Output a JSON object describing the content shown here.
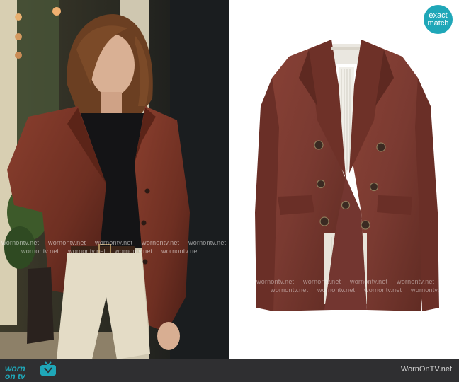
{
  "badge": {
    "line1": "exact",
    "line2": "match"
  },
  "footer": {
    "logo_line1": "worn",
    "logo_line2": "on tv",
    "site": "WornOnTV.net"
  },
  "watermark": "wornontv.net",
  "colors": {
    "badge_teal": "#1fa7b8",
    "footer_bg": "#2f2f31",
    "jacket_brown": "#7a3a31"
  }
}
